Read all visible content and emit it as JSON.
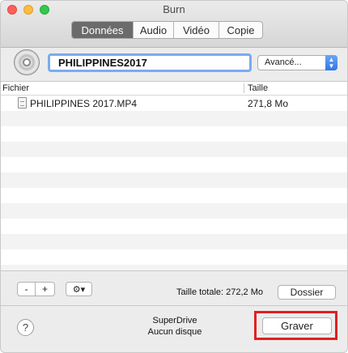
{
  "window": {
    "title": "Burn"
  },
  "tabs": [
    {
      "label": "Données",
      "active": true
    },
    {
      "label": "Audio",
      "active": false
    },
    {
      "label": "Vidéo",
      "active": false
    },
    {
      "label": "Copie",
      "active": false
    }
  ],
  "disc": {
    "icon": "cd-disc-icon",
    "name": "PHILIPPINES2017"
  },
  "advanced": {
    "label": "Avancé...",
    "icon": "select-arrows-icon"
  },
  "file_list": {
    "columns": [
      "Fichier",
      "Taille"
    ],
    "rows": [
      {
        "name": "PHILIPPINES 2017.MP4",
        "size": "271,8 Mo",
        "icon": "document-icon"
      }
    ]
  },
  "toolbar": {
    "remove_label": "-",
    "add_label": "+",
    "options_label": "⚙▾",
    "total_size": "Taille totale: 272,2 Mo",
    "folder_label": "Dossier"
  },
  "footer": {
    "help_label": "?",
    "drive_name": "SuperDrive",
    "drive_status": "Aucun disque",
    "burn_label": "Graver"
  },
  "colors": {
    "active_tab": "#6b6b6b",
    "focus_ring": "#7baaf0",
    "highlight": "#e02020",
    "select_accent": "#2f77e8"
  }
}
